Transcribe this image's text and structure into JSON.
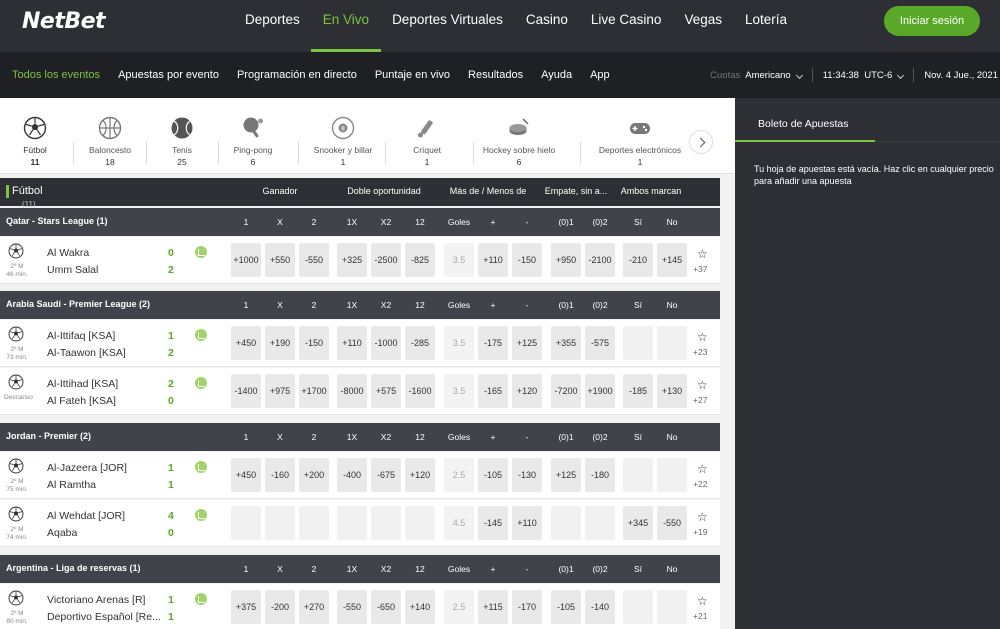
{
  "brand": {
    "logo_net": "Net",
    "logo_bet": "Bet",
    "accent": "#7cc242"
  },
  "main_nav": [
    "Deportes",
    "En Vivo",
    "Deportes Virtuales",
    "Casino",
    "Live Casino",
    "Vegas",
    "Lotería"
  ],
  "main_nav_active": "En Vivo",
  "login_label": "Iniciar sesión",
  "sub_nav": [
    "Todos los eventos",
    "Apuestas por evento",
    "Programación en directo",
    "Puntaje en vivo",
    "Resultados",
    "Ayuda",
    "App"
  ],
  "sub_right": {
    "odds_label": "Cuotas",
    "odds_value": "Americano",
    "time": "11:34:38",
    "tz": "UTC-6",
    "date": "Nov. 4 Jue., 2021"
  },
  "sports": [
    {
      "name": "Fútbol",
      "count": "11",
      "icon": "soccer-ball-icon"
    },
    {
      "name": "Baloncesto",
      "count": "18",
      "icon": "basketball-icon"
    },
    {
      "name": "Tenis",
      "count": "25",
      "icon": "tennis-ball-icon"
    },
    {
      "name": "Ping-pong",
      "count": "6",
      "icon": "ping-pong-icon"
    },
    {
      "name": "Snooker y billar",
      "count": "1",
      "icon": "billiard-ball-icon"
    },
    {
      "name": "Críquet",
      "count": "1",
      "icon": "cricket-bat-icon"
    },
    {
      "name": "Hockey sobre hielo",
      "count": "6",
      "icon": "hockey-puck-icon"
    },
    {
      "name": "Deportes electrónicos",
      "count": "1",
      "icon": "gamepad-icon"
    }
  ],
  "table": {
    "sport_title": "Fútbol",
    "sport_sub": "(11)",
    "groups": [
      "Ganador",
      "Doble oportunidad",
      "Más de / Menos de",
      "Empate, sin a...",
      "Ambos marcan"
    ]
  },
  "col_labels": [
    "1",
    "X",
    "2",
    "1X",
    "X2",
    "12",
    "Goles",
    "+",
    "-",
    "(0)1",
    "(0)2",
    "Sí",
    "No"
  ],
  "leagues": [
    {
      "name": "Qatar - Stars League (1)"
    },
    {
      "name": "Arabia Saudí - Premier League (2)"
    },
    {
      "name": "Jordan - Premier (2)"
    },
    {
      "name": "Argentina - Liga de reservas (1)"
    }
  ],
  "matches": [
    {
      "team1": "Al Wakra",
      "team2": "Umm Salal",
      "score1": "0",
      "score2": "2",
      "period": "2º M",
      "minute": "46 min.",
      "odds": [
        "+1000",
        "+550",
        "-550",
        "+325",
        "-2500",
        "-825",
        "3.5",
        "+110",
        "-150",
        "+950",
        "-2100",
        "-210",
        "+145"
      ],
      "more": "+37"
    },
    {
      "team1": "Al-Ittifaq [KSA]",
      "team2": "Al-Taawon [KSA]",
      "score1": "1",
      "score2": "2",
      "period": "2º M",
      "minute": "73 min.",
      "odds": [
        "+450",
        "+190",
        "-150",
        "+110",
        "-1000",
        "-285",
        "3.5",
        "-175",
        "+125",
        "+355",
        "-575",
        "",
        ""
      ],
      "more": "+23"
    },
    {
      "team1": "Al-Ittihad [KSA]",
      "team2": "Al Fateh [KSA]",
      "score1": "2",
      "score2": "0",
      "period": "Descanso",
      "minute": "",
      "odds": [
        "-1400",
        "+975",
        "+1700",
        "-8000",
        "+575",
        "-1600",
        "3.5",
        "-165",
        "+120",
        "-7200",
        "+1900",
        "-185",
        "+130"
      ],
      "more": "+27"
    },
    {
      "team1": "Al-Jazeera [JOR]",
      "team2": "Al Ramtha",
      "score1": "1",
      "score2": "1",
      "period": "2º M",
      "minute": "75 min.",
      "odds": [
        "+450",
        "-160",
        "+200",
        "-400",
        "-675",
        "+120",
        "2.5",
        "-105",
        "-130",
        "+125",
        "-180",
        "",
        ""
      ],
      "more": "+22"
    },
    {
      "team1": "Al Wehdat [JOR]",
      "team2": "Aqaba",
      "score1": "4",
      "score2": "0",
      "period": "2º M",
      "minute": "74 min.",
      "odds": [
        "",
        "",
        "",
        "",
        "",
        "",
        "4.5",
        "-145",
        "+110",
        "",
        "",
        "+345",
        "-550"
      ],
      "more": "+19"
    },
    {
      "team1": "Victoriano Arenas [R]",
      "team2": "Deportivo Español [Re...",
      "score1": "1",
      "score2": "1",
      "period": "2º M",
      "minute": "80 min.",
      "odds": [
        "+375",
        "-200",
        "+270",
        "-550",
        "-650",
        "+140",
        "2.5",
        "+115",
        "-170",
        "-105",
        "-140",
        "",
        ""
      ],
      "more": "+21"
    }
  ],
  "betslip": {
    "title": "Boleto de Apuestas",
    "message": "Tu hoja de apuestas está vacía. Haz clic en cualquier precio para añadir una apuesta"
  }
}
